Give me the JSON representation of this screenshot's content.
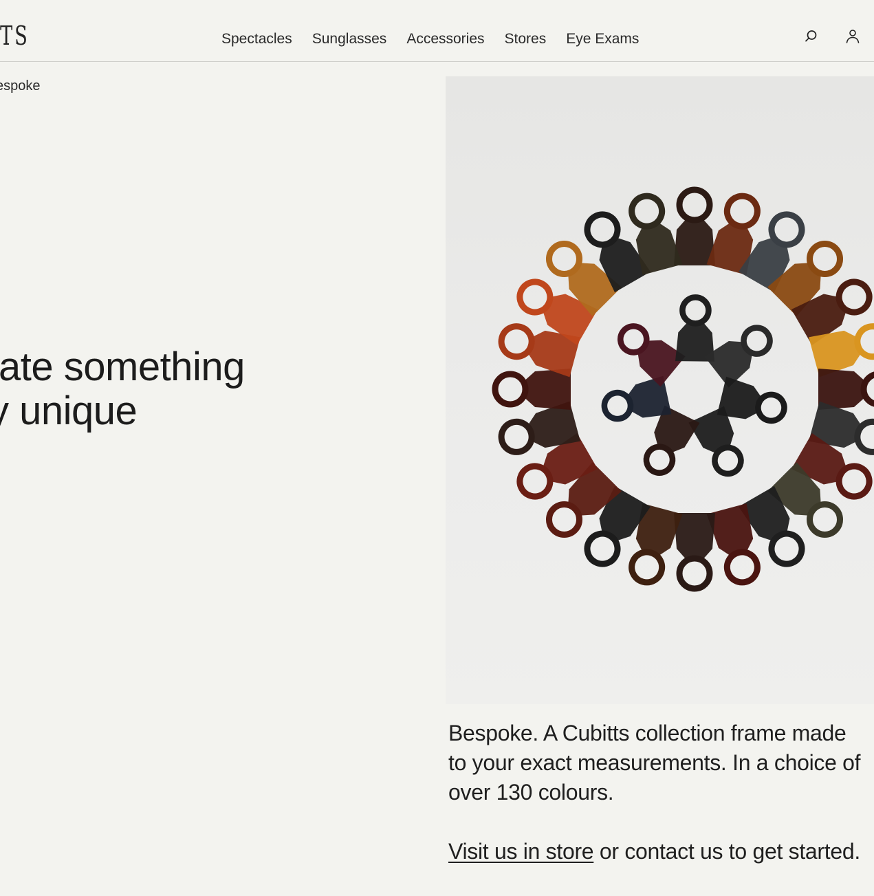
{
  "header": {
    "logo_text": "TS",
    "nav": [
      {
        "label": "Spectacles"
      },
      {
        "label": "Sunglasses"
      },
      {
        "label": "Accessories"
      },
      {
        "label": "Stores"
      },
      {
        "label": "Eye Exams"
      }
    ],
    "icons": {
      "search": "search-icon",
      "account": "account-icon"
    }
  },
  "breadcrumb": {
    "current": "espoke"
  },
  "hero": {
    "headline_line1": "ate something",
    "headline_line2": "y unique",
    "image_alt": "Circular arrangement of acetate colour swatches"
  },
  "caption": {
    "description": "Bespoke. A Cubitts collection frame made to your exact measurements. In a choice of over 130 colours.",
    "link_text": "Visit us in store",
    "cta_rest": " or contact us to get started."
  }
}
